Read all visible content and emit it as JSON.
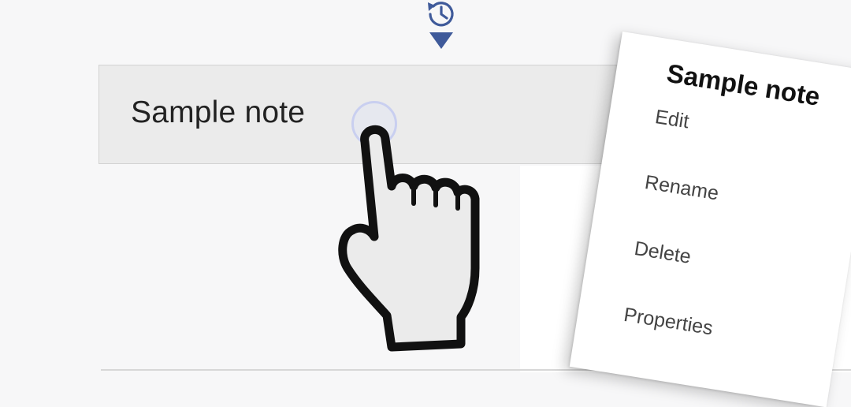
{
  "colors": {
    "accent": "#3f5a9a",
    "note_background": "#ebebeb",
    "tap_ring": "#c9cff0"
  },
  "toolbar": {
    "history_icon": "history-icon",
    "dropdown_icon": "triangle-down-icon"
  },
  "note": {
    "title": "Sample note"
  },
  "gesture": {
    "icon": "pointing-hand-icon"
  },
  "context_menu": {
    "title": "Sample note",
    "items": [
      {
        "label": "Edit"
      },
      {
        "label": "Rename"
      },
      {
        "label": "Delete"
      },
      {
        "label": "Properties"
      }
    ]
  }
}
